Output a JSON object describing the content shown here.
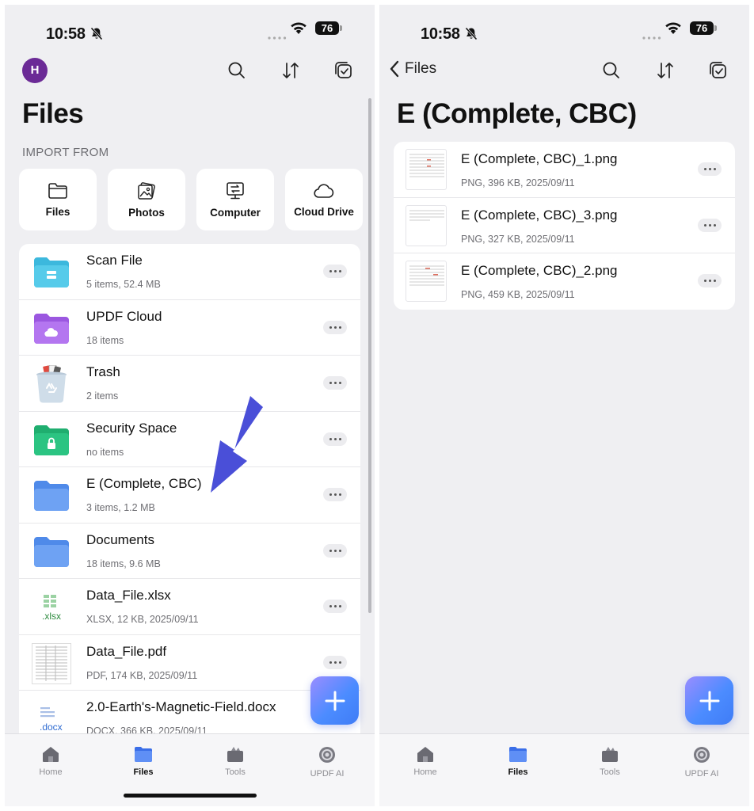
{
  "status": {
    "time": "10:58",
    "battery": "76"
  },
  "left": {
    "avatar_initial": "H",
    "title": "Files",
    "import_label": "IMPORT FROM",
    "import_sources": [
      {
        "label": "Files",
        "icon": "folder-outline-icon"
      },
      {
        "label": "Photos",
        "icon": "photos-icon"
      },
      {
        "label": "Computer",
        "icon": "computer-transfer-icon"
      },
      {
        "label": "Cloud Drive",
        "icon": "cloud-icon"
      }
    ],
    "items": [
      {
        "name": "Scan File",
        "meta": "5 items, 52.4 MB",
        "icon": "scan-folder-icon"
      },
      {
        "name": "UPDF Cloud",
        "meta": "18 items",
        "icon": "cloud-folder-icon"
      },
      {
        "name": "Trash",
        "meta": "2 items",
        "icon": "trash-bin-icon"
      },
      {
        "name": "Security Space",
        "meta": "no items",
        "icon": "secure-folder-icon"
      },
      {
        "name": "E (Complete, CBC)",
        "meta": "3 items, 1.2 MB",
        "icon": "folder-icon"
      },
      {
        "name": "Documents",
        "meta": "18 items, 9.6 MB",
        "icon": "folder-icon"
      },
      {
        "name": "Data_File.xlsx",
        "meta": "XLSX, 12 KB, 2025/09/11",
        "icon": "xlsx-file-icon",
        "ext": ".xlsx"
      },
      {
        "name": "Data_File.pdf",
        "meta": "PDF, 174 KB, 2025/09/11",
        "icon": "pdf-thumbnail-icon"
      },
      {
        "name": "2.0-Earth's-Magnetic-Field.docx",
        "meta": "DOCX, 366 KB, 2025/09/11",
        "icon": "docx-file-icon",
        "ext": ".docx"
      }
    ]
  },
  "right": {
    "back_label": "Files",
    "title": "E (Complete, CBC)",
    "items": [
      {
        "name": "E (Complete, CBC)_1.png",
        "meta": "PNG, 396 KB, 2025/09/11"
      },
      {
        "name": "E (Complete, CBC)_3.png",
        "meta": "PNG, 327 KB, 2025/09/11"
      },
      {
        "name": "E (Complete, CBC)_2.png",
        "meta": "PNG, 459 KB, 2025/09/11"
      }
    ]
  },
  "tabs": [
    {
      "label": "Home",
      "icon": "home-icon"
    },
    {
      "label": "Files",
      "icon": "files-icon",
      "active": true
    },
    {
      "label": "Tools",
      "icon": "tools-icon"
    },
    {
      "label": "UPDF AI",
      "icon": "updf-ai-icon"
    }
  ],
  "colors": {
    "accent": "#3f7cf6",
    "arrow": "#4a4fd8",
    "avatar": "#6b2a96"
  }
}
